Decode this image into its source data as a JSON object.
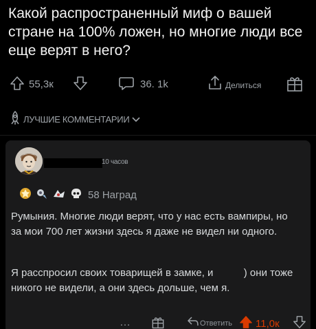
{
  "post": {
    "title": "Какой распространенный миф о вашей стране на 100% ложен, но многие люди все еще верят в него?",
    "score": "55,3к",
    "comments_count": "36. 1k",
    "share_label": "Делиться"
  },
  "sort": {
    "label": "ЛУЧШИЕ КОММЕНТАРИИ"
  },
  "comment": {
    "time": "10 часов",
    "awards_count": "58 Наград",
    "paragraph_1": "Румыния. Многие люди верят, что у нас есть вампиры, но за мои 700 лет жизни здесь я даже не видел ни одного.",
    "paragraph_2": "Я расспросил своих товарищей в замке, и               ) они тоже никого не видели, а они здесь дольше, чем я.",
    "more": "…",
    "reply_label": "Ответить",
    "score": "11,0к"
  },
  "colors": {
    "background": "#000000",
    "card": "#1a1a1b",
    "upvoted": "#d93a00",
    "muted": "#9ea3a8"
  },
  "icons": [
    "upvote-icon",
    "downvote-icon",
    "comment-icon",
    "share-icon",
    "award-icon",
    "rocket-icon",
    "reply-icon"
  ]
}
